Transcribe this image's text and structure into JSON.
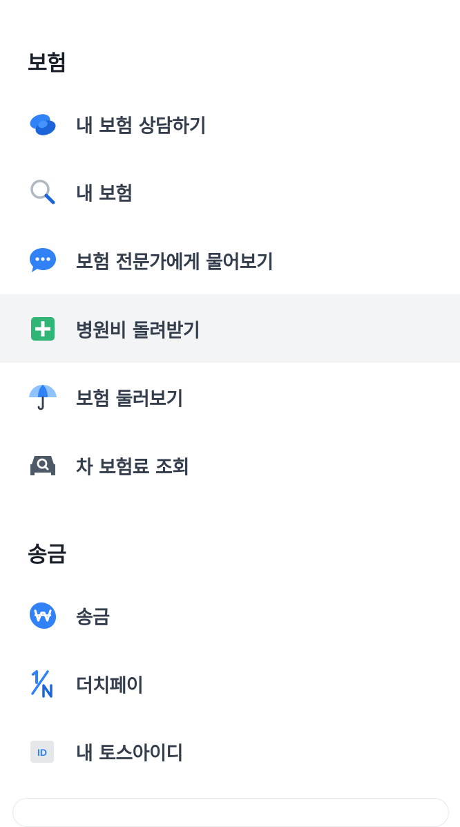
{
  "insurance": {
    "title": "보험",
    "items": [
      {
        "label": "내 보험 상담하기",
        "icon": "consult-leaf-icon"
      },
      {
        "label": "내 보험",
        "icon": "search-icon"
      },
      {
        "label": "보험 전문가에게 물어보기",
        "icon": "chat-bubble-icon"
      },
      {
        "label": "병원비 돌려받기",
        "icon": "plus-square-icon"
      },
      {
        "label": "보험 둘러보기",
        "icon": "umbrella-icon"
      },
      {
        "label": "차 보험료 조회",
        "icon": "car-search-icon"
      }
    ]
  },
  "transfer": {
    "title": "송금",
    "items": [
      {
        "label": "송금",
        "icon": "won-icon"
      },
      {
        "label": "더치페이",
        "icon": "one-over-n-icon"
      },
      {
        "label": "내 토스아이디",
        "icon": "id-badge-icon"
      }
    ],
    "id_badge_text": "ID"
  },
  "colors": {
    "blue": "#3182f6",
    "green": "#2fb677",
    "gray_icon": "#4e5968",
    "highlight_bg": "#f2f4f6",
    "title_text": "#191f28",
    "item_text": "#333d4b"
  }
}
